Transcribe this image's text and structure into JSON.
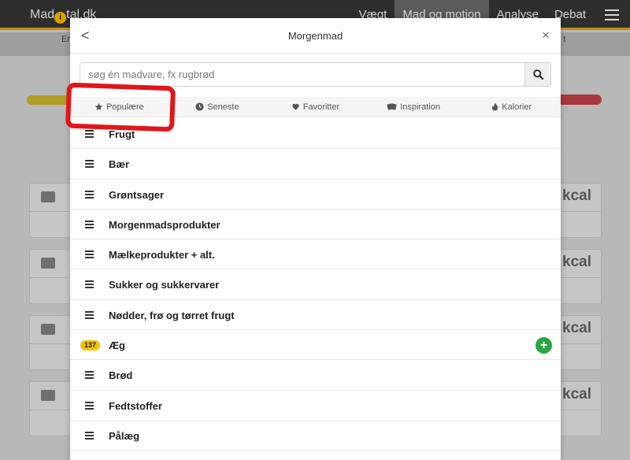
{
  "app": {
    "logo_pre": "Mad",
    "logo_mid": "i",
    "logo_post": "tal.dk",
    "nav": [
      "Vægt",
      "Mad og motion",
      "Analyse",
      "Debat"
    ],
    "subbar_left": "Er",
    "subbar_right": "t",
    "cards_kcal": [
      "kcal",
      "kcal",
      "kcal",
      "kcal"
    ]
  },
  "modal": {
    "back_label": "<",
    "title": "Morgenmad",
    "close_label": "×",
    "search": {
      "placeholder": "søg én madvare, fx rugbrød",
      "value": ""
    },
    "tabs": [
      {
        "label": "Populære",
        "icon": "star-icon"
      },
      {
        "label": "Seneste",
        "icon": "clock-icon"
      },
      {
        "label": "Favoritter",
        "icon": "heart-icon"
      },
      {
        "label": "Inspiration",
        "icon": "cards-icon"
      },
      {
        "label": "Kalorier",
        "icon": "flame-icon"
      }
    ],
    "items": [
      {
        "label": "Frugt"
      },
      {
        "label": "Bær"
      },
      {
        "label": "Grøntsager"
      },
      {
        "label": "Morgenmadsprodukter"
      },
      {
        "label": "Mælkeprodukter + alt."
      },
      {
        "label": "Sukker og sukkervarer"
      },
      {
        "label": "Nødder, frø og tørret frugt"
      },
      {
        "label": "Æg",
        "badge": "137",
        "add_label": "+"
      },
      {
        "label": "Brød"
      },
      {
        "label": "Fedtstoffer"
      },
      {
        "label": "Pålæg"
      }
    ]
  },
  "colors": {
    "highlight": "#e0161a",
    "badge": "#f2c200",
    "add": "#2da344",
    "topbar_accent": "#c68b00"
  }
}
